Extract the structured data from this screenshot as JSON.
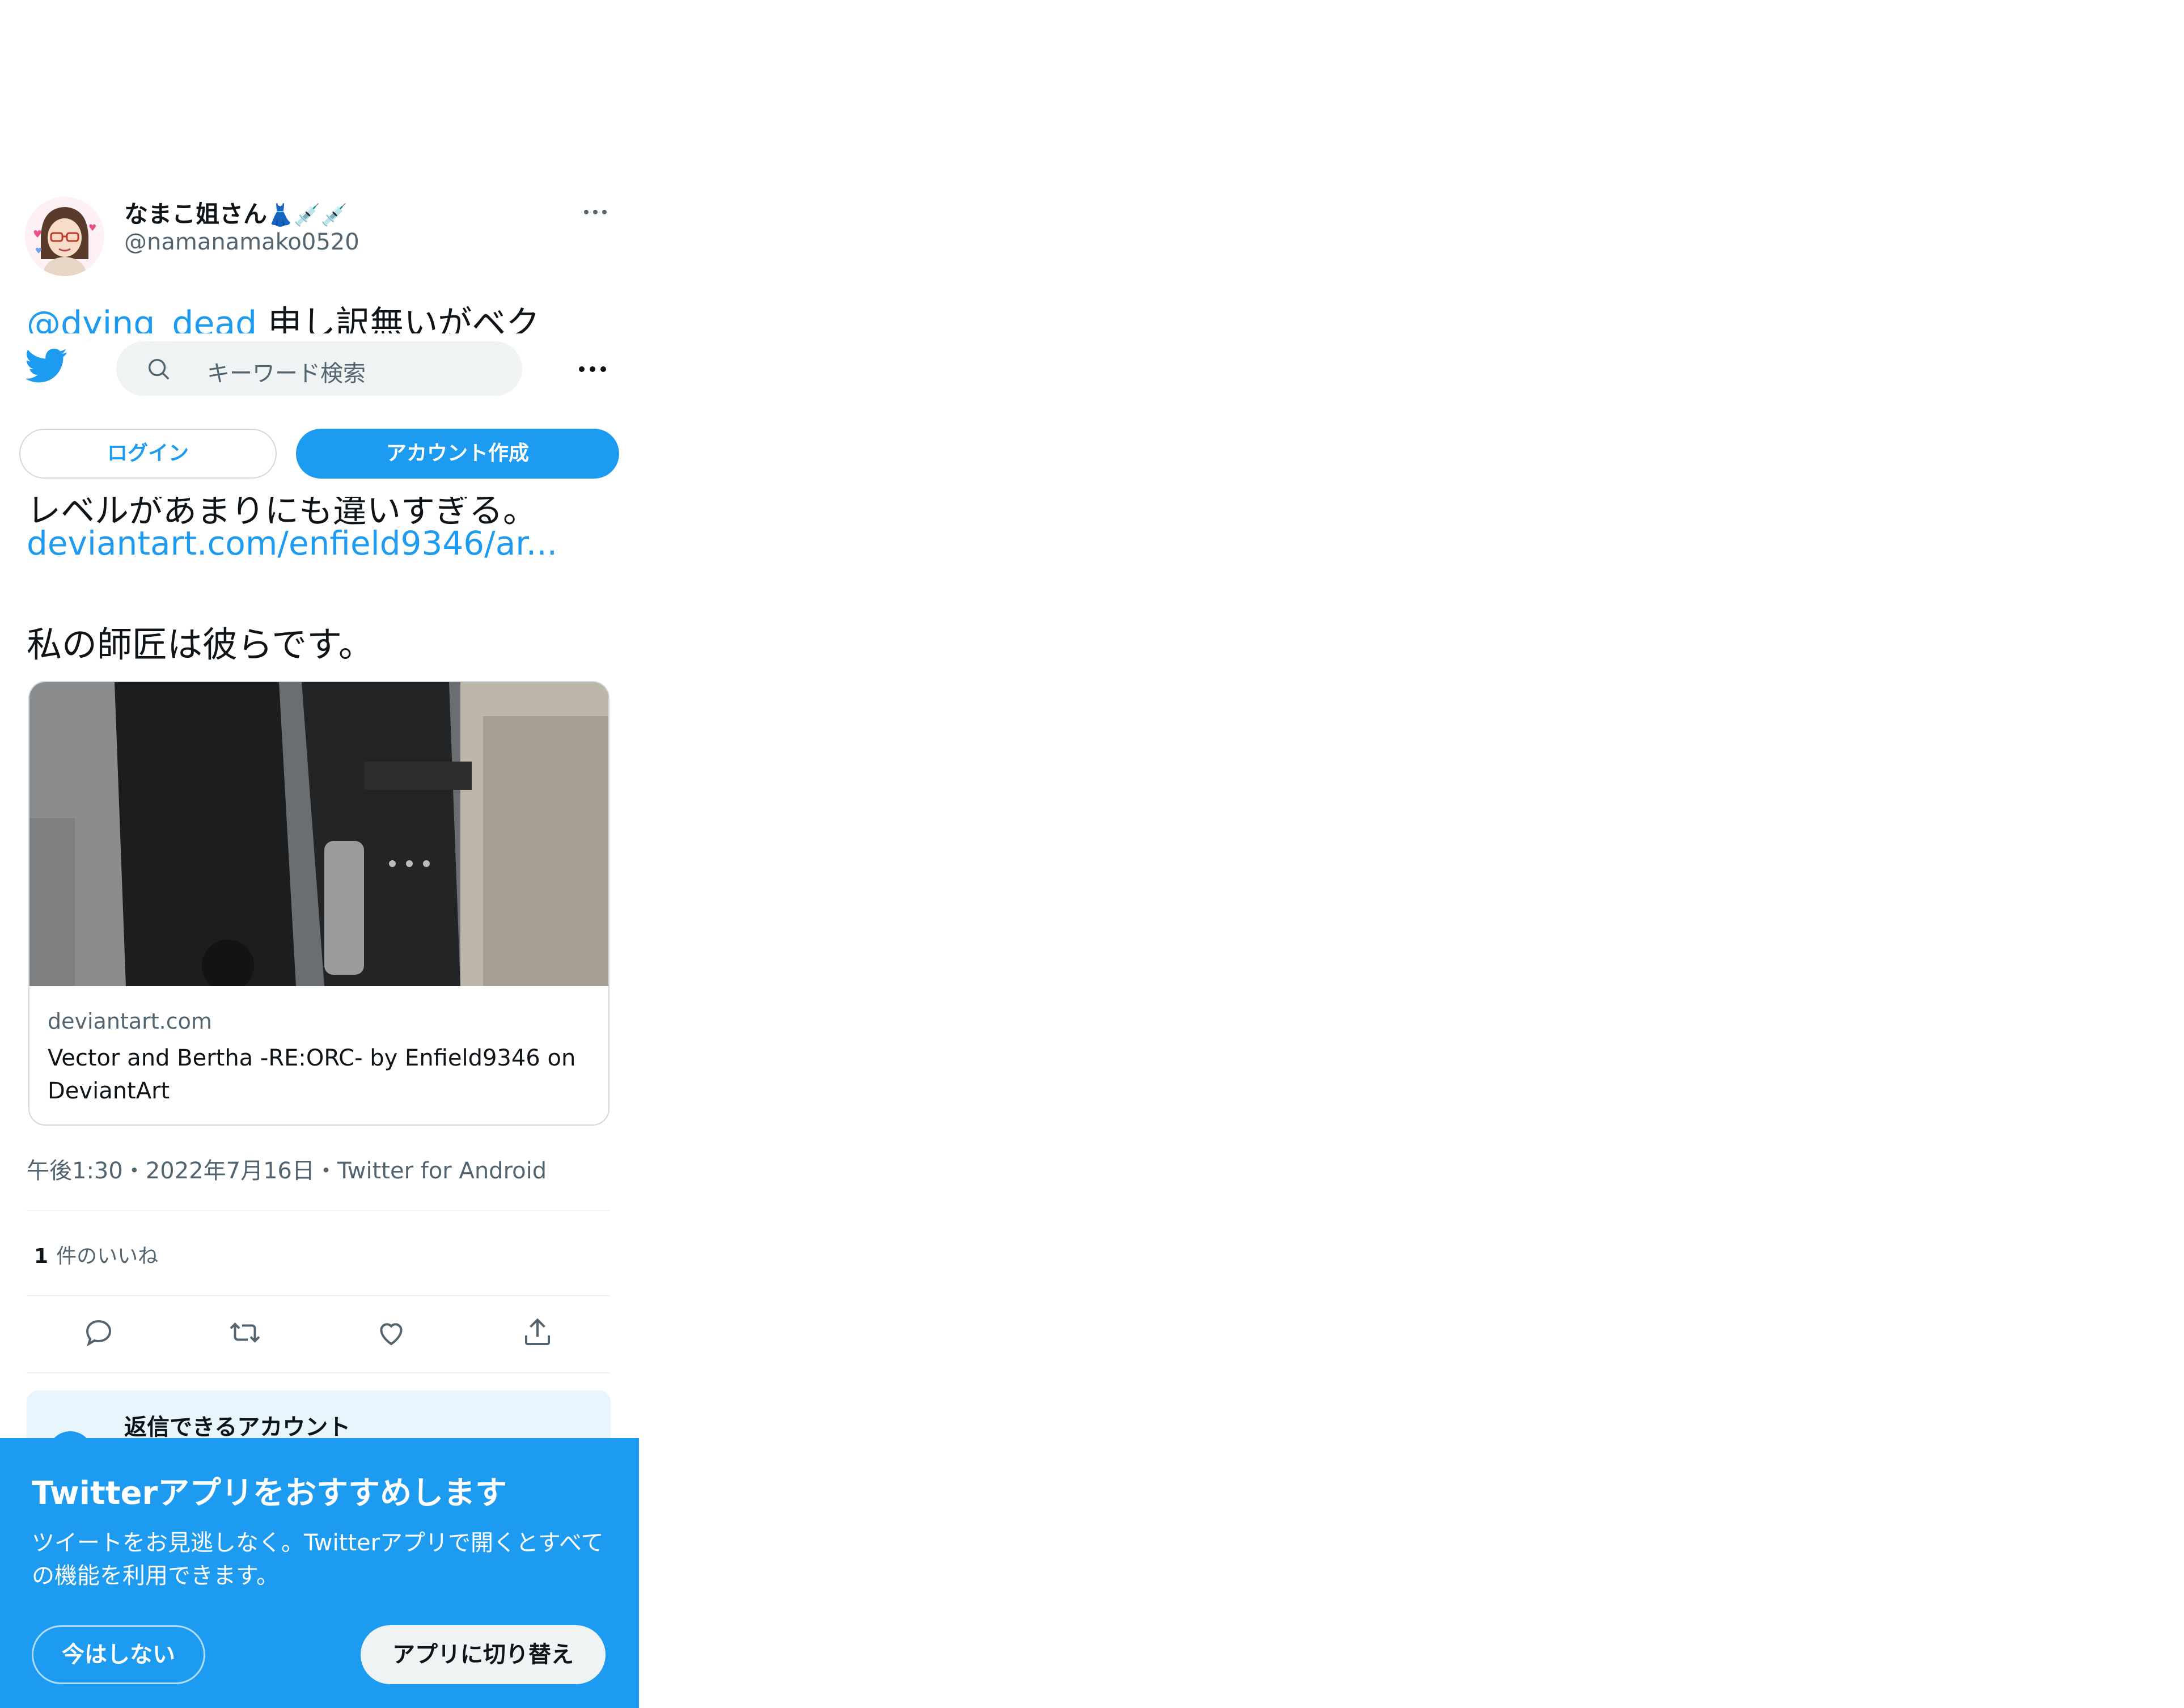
{
  "tweet": {
    "display_name": "なまこ姐さん",
    "name_emoji": "👗💉💉",
    "handle": "@namanamako0520",
    "mention": "@dying_dead",
    "text_line1": " 申し訳無いがベク",
    "text_line_cut": "レベルがあまりにも違いすぎる。",
    "link": "deviantart.com/enfield9346/ar...",
    "text_line_last": "私の師匠は彼らです。",
    "card": {
      "domain": "deviantart.com",
      "title": "Vector and Bertha -RE:ORC- by Enfield9346 on DeviantArt"
    },
    "meta": "午後1:30・2022年7月16日・Twitter for Android",
    "likes_count": "1",
    "likes_label": "件のいいね"
  },
  "topbar": {
    "search_placeholder": "キーワード検索",
    "login_label": "ログイン",
    "signup_label": "アカウント作成"
  },
  "reply_box": {
    "title": "返信できるアカウント"
  },
  "banner": {
    "title": "Twitterアプリをおすすめします",
    "description": "ツイートをお見逃しなく。Twitterアプリで開くとすべての機能を利用できます。",
    "not_now_label": "今はしない",
    "switch_label": "アプリに切り替え"
  },
  "colors": {
    "accent": "#1d9bf0",
    "text": "#0f1419",
    "secondary": "#536471"
  }
}
